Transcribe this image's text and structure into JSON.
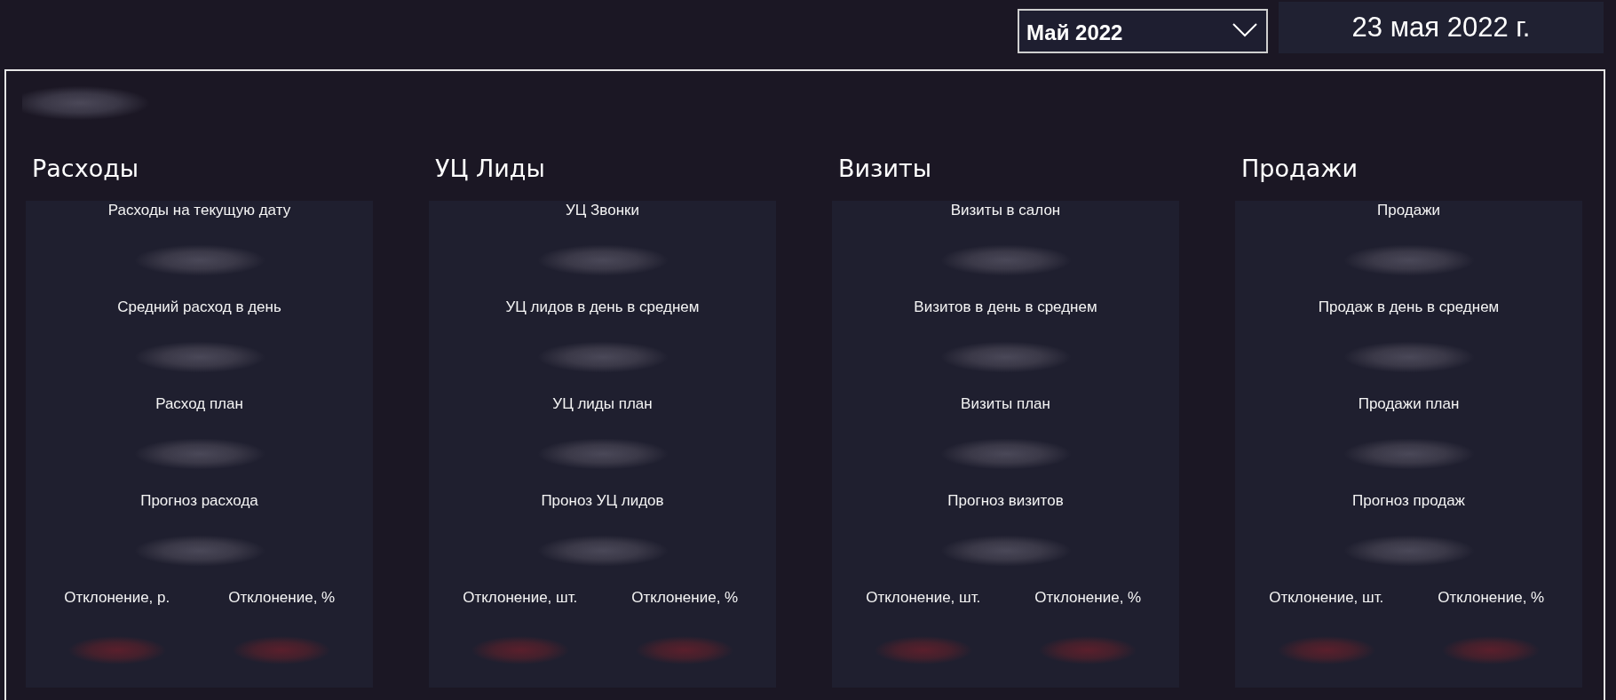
{
  "period_select": {
    "value": "Май 2022"
  },
  "current_date": "23 мая 2022 г.",
  "dashboard": {
    "blurred_title": true,
    "sections": [
      {
        "title": "Расходы",
        "metrics": [
          {
            "kind": "value",
            "label": "Расходы на текущую дату"
          },
          {
            "kind": "value",
            "label": "Средний расход в день"
          },
          {
            "kind": "value",
            "label": "Расход план"
          },
          {
            "kind": "value",
            "label": "Прогноз расхода"
          },
          {
            "kind": "deviation",
            "label": "Отклонение, р."
          },
          {
            "kind": "deviation",
            "label": "Отклонение, %"
          }
        ]
      },
      {
        "title": "УЦ Лиды",
        "metrics": [
          {
            "kind": "value",
            "label": "УЦ Звонки"
          },
          {
            "kind": "value",
            "label": "УЦ лидов в день в среднем"
          },
          {
            "kind": "value",
            "label": "УЦ лиды план"
          },
          {
            "kind": "value",
            "label": "Проноз УЦ лидов"
          },
          {
            "kind": "deviation",
            "label": "Отклонение, шт."
          },
          {
            "kind": "deviation",
            "label": "Отклонение, %"
          }
        ]
      },
      {
        "title": "Визиты",
        "metrics": [
          {
            "kind": "value",
            "label": "Визиты в салон"
          },
          {
            "kind": "value",
            "label": "Визитов в день в среднем"
          },
          {
            "kind": "value",
            "label": "Визиты план"
          },
          {
            "kind": "value",
            "label": "Прогноз визитов"
          },
          {
            "kind": "deviation",
            "label": "Отклонение, шт."
          },
          {
            "kind": "deviation",
            "label": "Отклонение, %"
          }
        ]
      },
      {
        "title": "Продажи",
        "metrics": [
          {
            "kind": "value",
            "label": "Продажи"
          },
          {
            "kind": "value",
            "label": "Продаж в день в среднем"
          },
          {
            "kind": "value",
            "label": "Продажи план"
          },
          {
            "kind": "value",
            "label": "Прогноз продаж"
          },
          {
            "kind": "deviation",
            "label": "Отклонение, шт."
          },
          {
            "kind": "deviation",
            "label": "Отклонение, %"
          }
        ]
      }
    ]
  }
}
